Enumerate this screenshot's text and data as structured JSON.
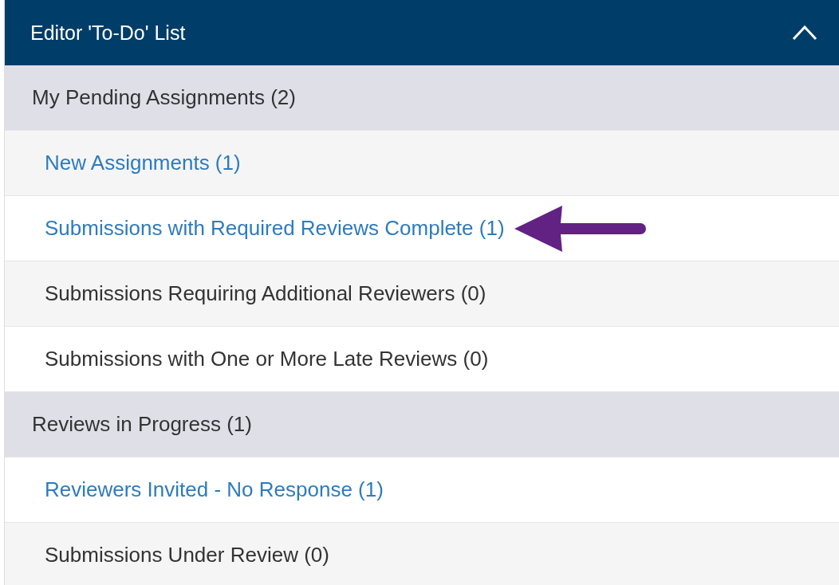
{
  "panel": {
    "title": "Editor 'To-Do' List",
    "expanded": true
  },
  "groups": [
    {
      "label": "My Pending Assignments (2)",
      "items": [
        {
          "label": "New Assignments (1)",
          "link": true,
          "arrow": false
        },
        {
          "label": "Submissions with Required Reviews Complete (1)",
          "link": true,
          "arrow": true
        },
        {
          "label": "Submissions Requiring Additional Reviewers (0)",
          "link": false,
          "arrow": false
        },
        {
          "label": "Submissions with One or More Late Reviews (0)",
          "link": false,
          "arrow": false
        }
      ]
    },
    {
      "label": "Reviews in Progress (1)",
      "items": [
        {
          "label": "Reviewers Invited - No Response (1)",
          "link": true,
          "arrow": false
        },
        {
          "label": "Submissions Under Review (0)",
          "link": false,
          "arrow": false
        }
      ]
    }
  ]
}
